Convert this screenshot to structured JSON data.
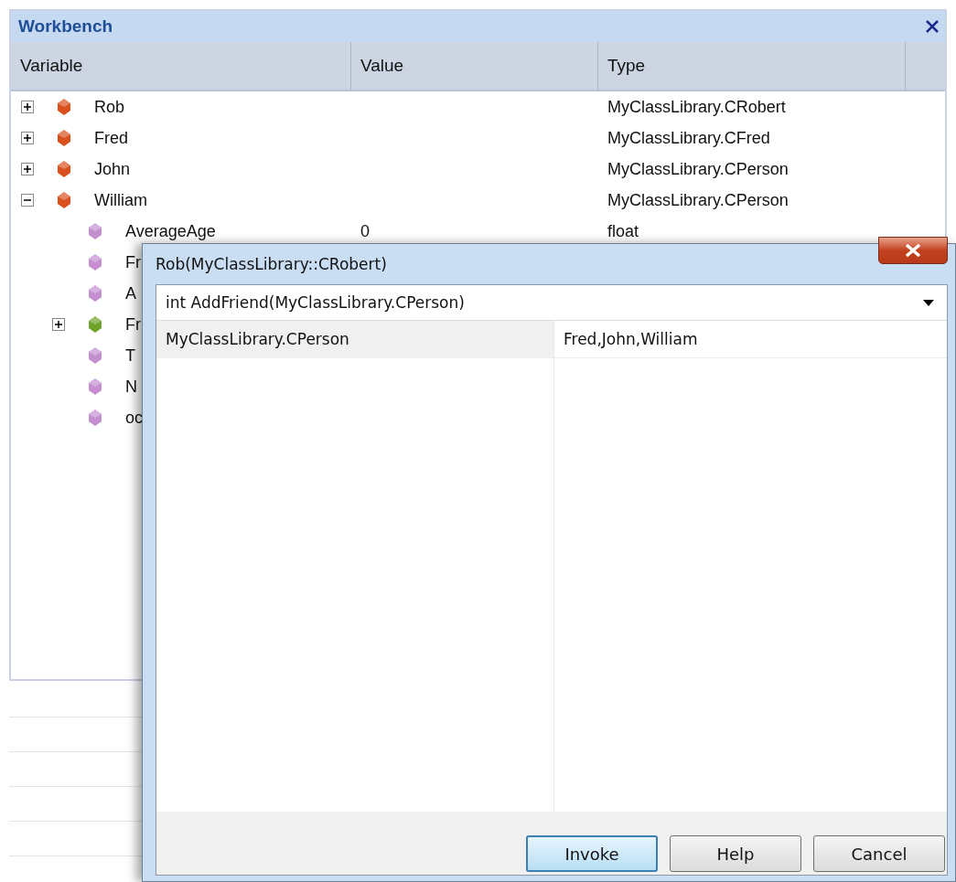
{
  "panel": {
    "title": "Workbench"
  },
  "columns": [
    "Variable",
    "Value",
    "Type"
  ],
  "rows": [
    {
      "name": "Rob",
      "type": "MyClassLibrary.CRobert",
      "color": "#d9501e",
      "expanded": false
    },
    {
      "name": "Fred",
      "type": "MyClassLibrary.CFred",
      "color": "#d9501e",
      "expanded": false
    },
    {
      "name": "John",
      "type": "MyClassLibrary.CPerson",
      "color": "#d9501e",
      "expanded": false
    },
    {
      "name": "William",
      "type": "MyClassLibrary.CPerson",
      "color": "#d9501e",
      "expanded": true,
      "children": [
        {
          "name": "AverageAge",
          "value": "0",
          "type": "float",
          "color": "#c58fd0"
        },
        {
          "name": "Fr",
          "color": "#c58fd0"
        },
        {
          "name": "A",
          "color": "#c58fd0"
        },
        {
          "name": "Fr",
          "color": "#6fa32a",
          "expanded": false
        },
        {
          "name": "T",
          "color": "#c58fd0"
        },
        {
          "name": "N",
          "color": "#c58fd0"
        },
        {
          "name": "oc",
          "color": "#c58fd0"
        }
      ]
    }
  ],
  "dialog": {
    "title": "Rob(MyClassLibrary::CRobert)",
    "method": "int AddFriend(MyClassLibrary.CPerson)",
    "params": [
      {
        "type": "MyClassLibrary.CPerson",
        "value": "Fred,John,William"
      }
    ],
    "buttons": [
      {
        "label": "Invoke",
        "default": true
      },
      {
        "label": "Help",
        "default": false
      },
      {
        "label": "Cancel",
        "default": false
      }
    ]
  }
}
